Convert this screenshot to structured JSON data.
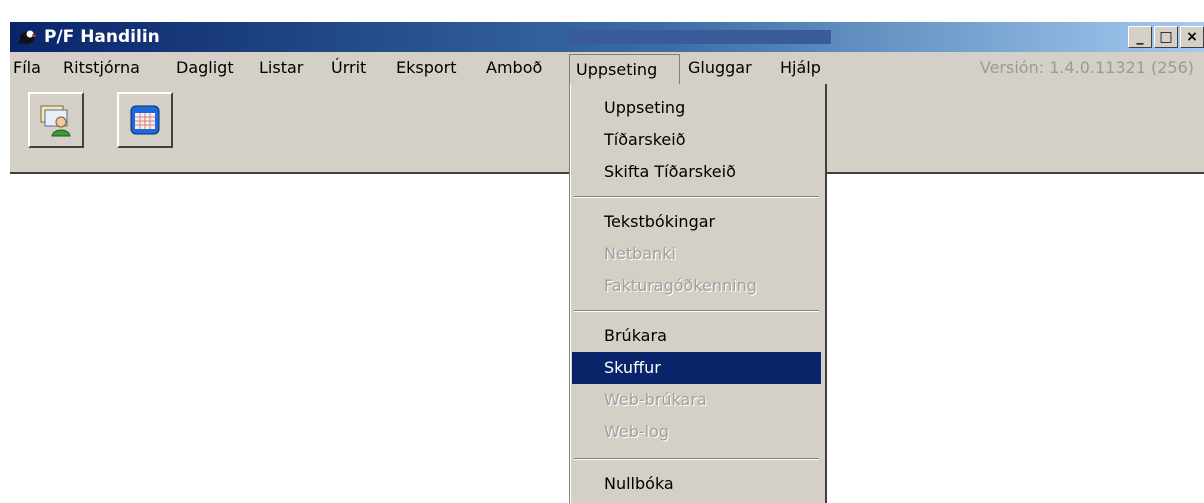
{
  "window": {
    "title": "P/F Handilin",
    "minimize": "_",
    "maximize": "□",
    "close": "×"
  },
  "menubar": {
    "items": [
      "Fíla",
      "Ritstjórna",
      "Dagligt",
      "Listar",
      "Úrrit",
      "Eksport",
      "Amboð",
      "Uppseting",
      "Gluggar",
      "Hjálp"
    ],
    "version": "Versión: 1.4.0.11321 (256)"
  },
  "toolbar": {
    "buttons": [
      {
        "icon": "contacts-icon"
      },
      {
        "icon": "calendar-icon"
      }
    ]
  },
  "dropdown": {
    "items": [
      {
        "label": "Uppseting",
        "enabled": true
      },
      {
        "label": "Tíðarskeið",
        "enabled": true
      },
      {
        "label": "Skifta Tíðarskeið",
        "enabled": true
      },
      {
        "label": "Tekstbókingar",
        "enabled": true
      },
      {
        "label": "Netbanki",
        "enabled": false
      },
      {
        "label": "Fakturagóðkenning",
        "enabled": false
      },
      {
        "label": "Brúkara",
        "enabled": true
      },
      {
        "label": "Skuffur",
        "enabled": true,
        "highlighted": true
      },
      {
        "label": "Web-brúkara",
        "enabled": false
      },
      {
        "label": "Web-log",
        "enabled": false
      },
      {
        "label": "Nullbóka",
        "enabled": true
      }
    ]
  },
  "colors": {
    "titlebar_start": "#0a246a",
    "highlight": "#0a246a",
    "face": "#d4d0c8",
    "disabled": "#a0a0a0"
  }
}
